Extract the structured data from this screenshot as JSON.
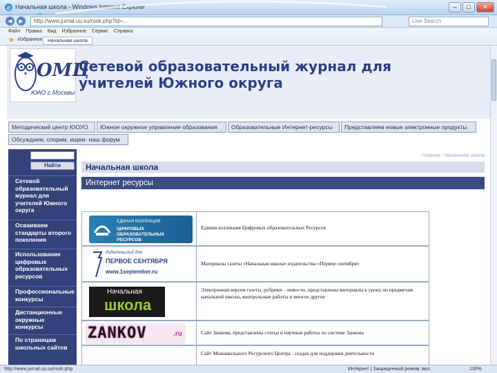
{
  "browser": {
    "window_title": "Начальная школа - Windows Internet Explorer",
    "url": "http://www.jurnal.uu.su/rosk.php?id=...",
    "search_placeholder": "Live Search",
    "menu": [
      "Файл",
      "Правка",
      "Вид",
      "Избранное",
      "Сервис",
      "Справка"
    ],
    "favorites_label": "Избранное",
    "tab_label": "Начальная школа",
    "status_url": "http://www.jurnal.uu.su/rosk.php",
    "status_zone": "Интернет | Защищенный режим: вкл.",
    "zoom": "100%"
  },
  "header": {
    "logo_text": "ОМЦ",
    "logo_caption": "ЮАО г.Москвы",
    "title": "Сетевой образовательный журнал для учителей Южного округа"
  },
  "topnav": [
    "Методический центр ЮОУО",
    "Южное окружное управление образования",
    "Образовательные Интернет-ресурсы",
    "Представляем новые электронные продукты",
    "Обсуждаем, спорим, ищем- наш форум"
  ],
  "sidebar": {
    "search_button": "Найти",
    "items": [
      "Сетевой образовательный журнал для учителей Южного округа",
      "Осваиваем стандарты второго поколения",
      "Использование цифровых образовательных ресурсов",
      "Профессиональные конкурсы",
      "Дистанционные окружные конкурсы",
      "По страницам школьных сайтов"
    ]
  },
  "content": {
    "breadcrumb": "Главная · Начальная школа",
    "section_title": "Начальная школа",
    "subsection_title": "Интернет ресурсы",
    "resources": [
      {
        "logo_line1": "ЕДИНАЯ КОЛЛЕКЦИЯ",
        "logo_line2": "ЦИФРОВЫХ ОБРАЗОВАТЕЛЬНЫХ РЕСУРСОВ",
        "text": "Единая коллекция Цифровых образовательных Ресурсов"
      },
      {
        "logo_line1": "Издательский дом",
        "logo_line2": "ПЕРВОЕ СЕНТЯБРЯ",
        "logo_line3": "www.1september.ru",
        "text": "Материалы газеты «Начальная школа» издательства «Первое сентября»"
      },
      {
        "logo_line1": "Начальная",
        "logo_line2": "школа",
        "text": "Электронная версия газеты, рубрики – новости, представлены материалы к уроку по предметам начальной школы, контрольные работы и многое другое"
      },
      {
        "logo_line1": "ZANKOV",
        "logo_line2": ".ru",
        "text": "Сайт Занкова, представлены статьи и научные работы по системе Занкова"
      },
      {
        "text": "Сайт Межшкольного Ресурсного Центра , создан для поддержки деятельности"
      }
    ]
  },
  "colors": {
    "sidebar_bg": "#33427a",
    "title_color": "#2b3f86",
    "header_bg": "#e9edf7"
  }
}
